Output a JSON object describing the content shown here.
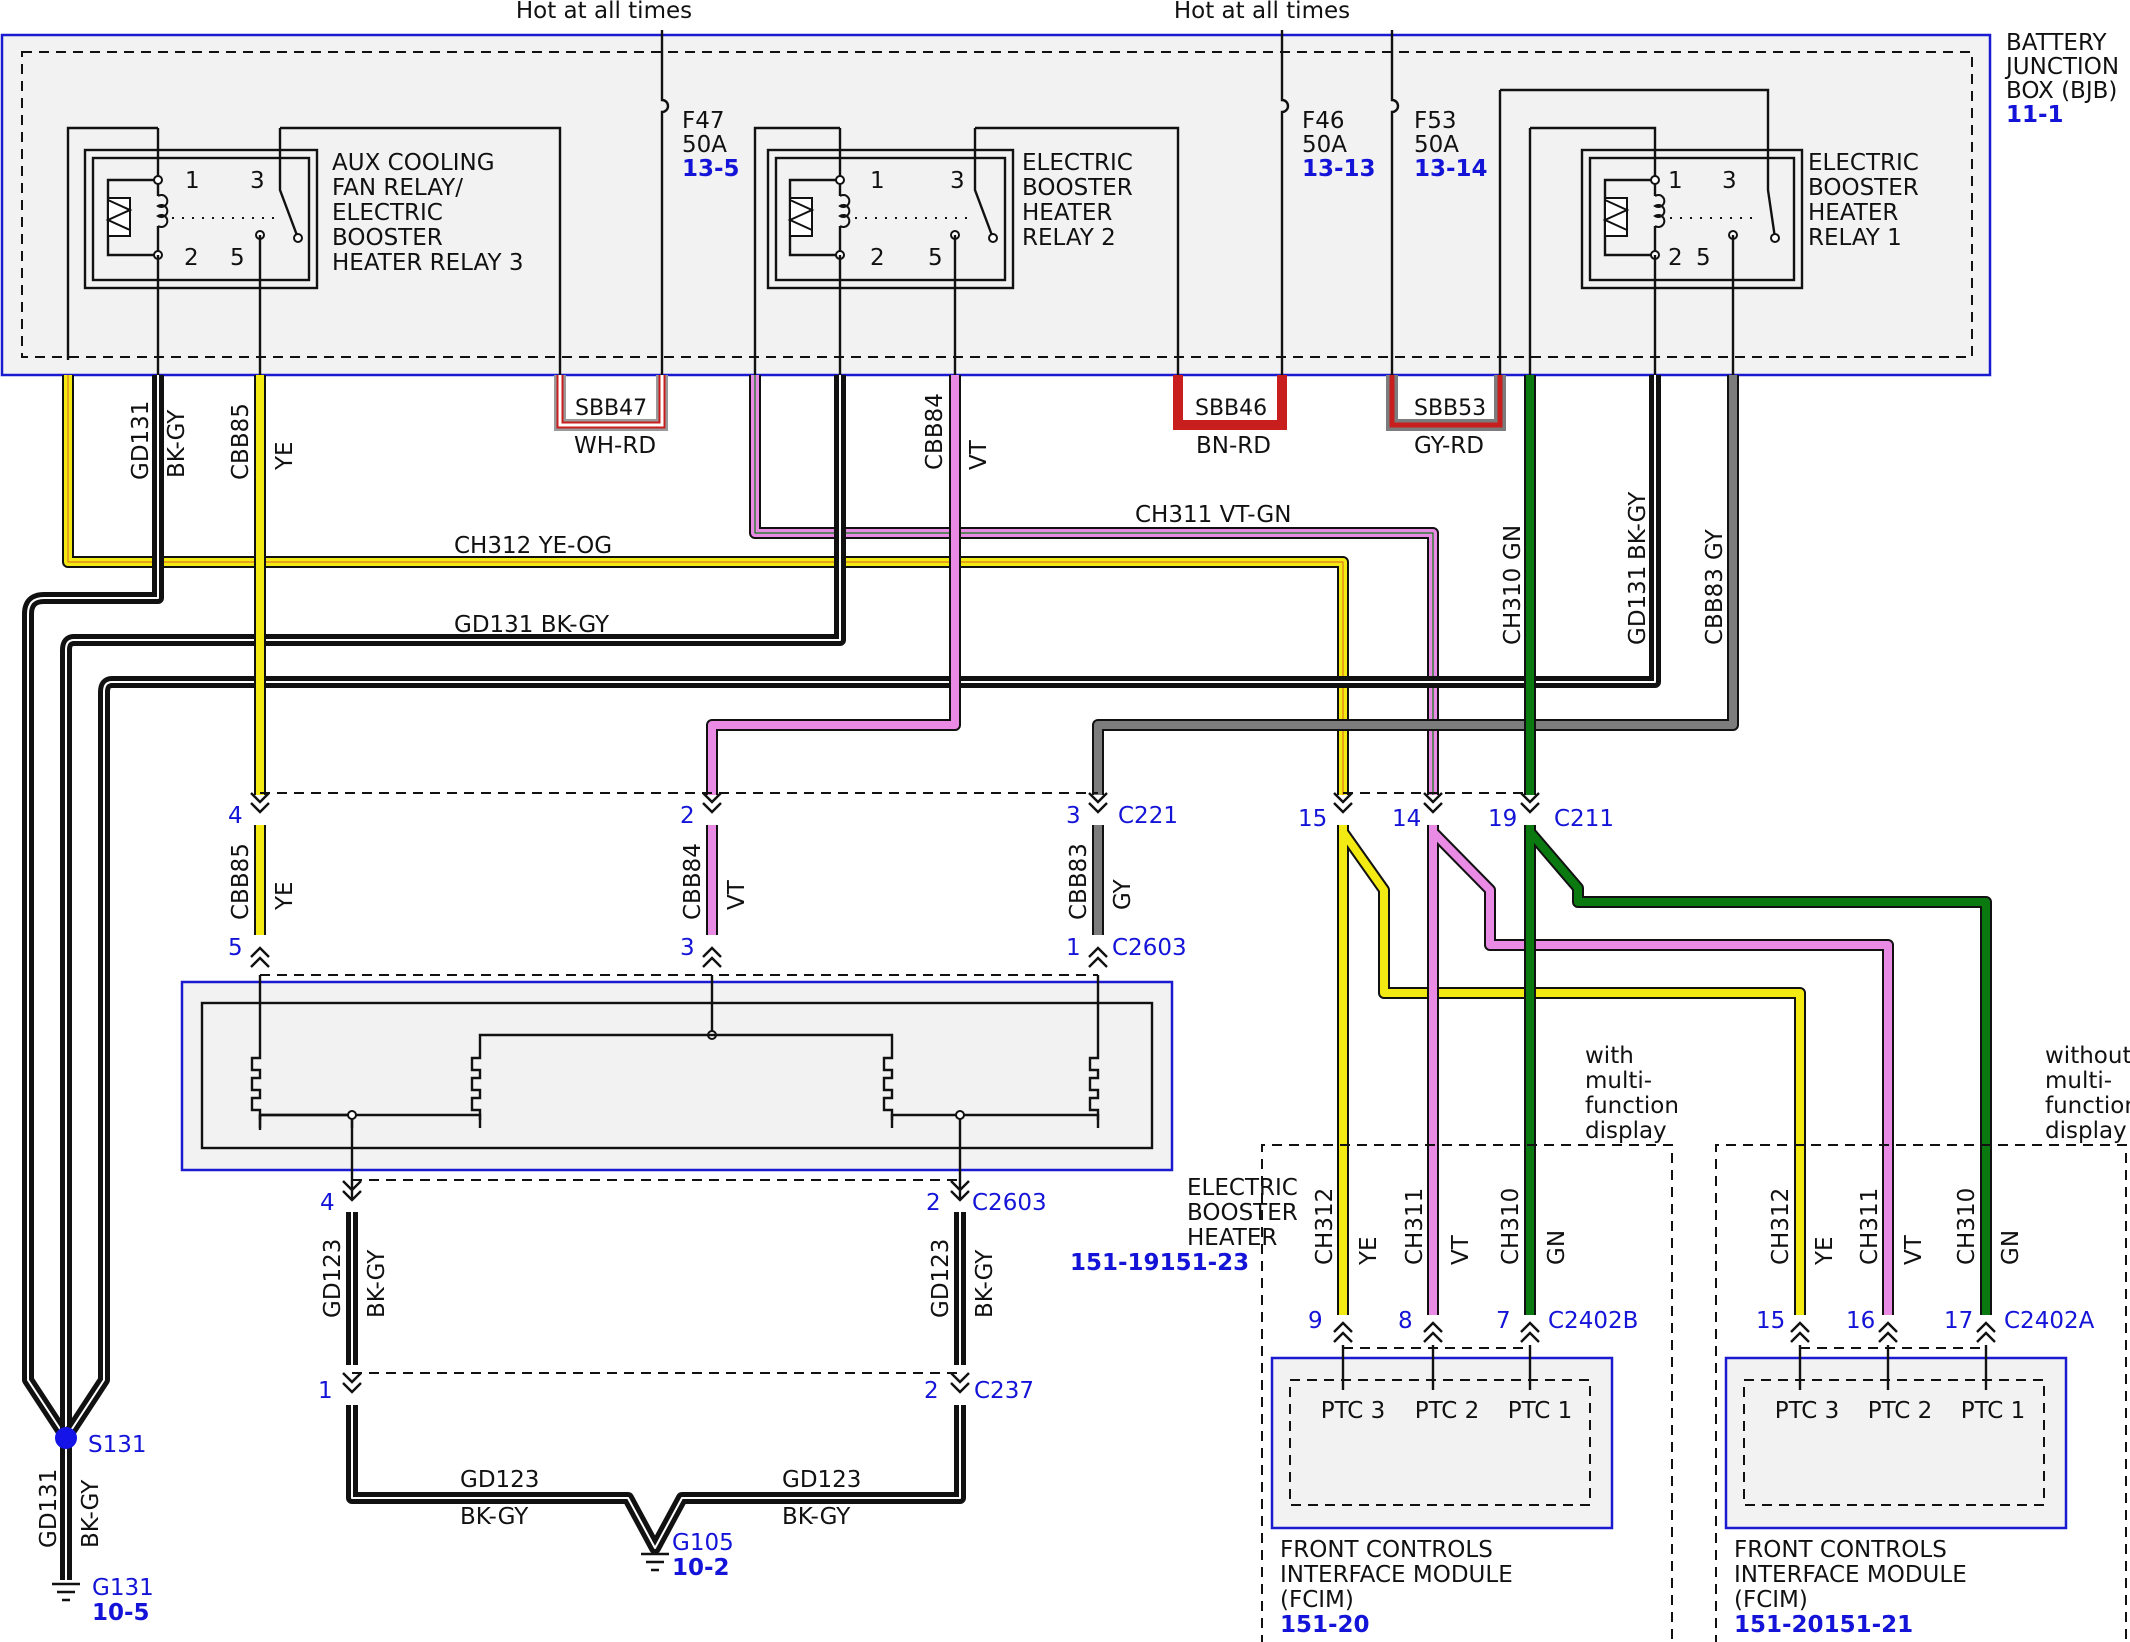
{
  "hot_label_1": "Hot at all times",
  "hot_label_2": "Hot at all times",
  "bjb": {
    "line1": "BATTERY",
    "line2": "JUNCTION",
    "line3": "BOX (BJB)",
    "ref": "11-1"
  },
  "relay3": {
    "l1": "AUX COOLING",
    "l2": "FAN RELAY/",
    "l3": "ELECTRIC",
    "l4": "BOOSTER",
    "l5": "HEATER RELAY 3",
    "p1": "1",
    "p2": "2",
    "p3": "3",
    "p5": "5"
  },
  "relay2": {
    "l1": "ELECTRIC",
    "l2": "BOOSTER",
    "l3": "HEATER",
    "l4": "RELAY 2",
    "p1": "1",
    "p2": "2",
    "p3": "3",
    "p5": "5"
  },
  "relay1": {
    "l1": "ELECTRIC",
    "l2": "BOOSTER",
    "l3": "HEATER",
    "l4": "RELAY 1",
    "p1": "1",
    "p2": "2",
    "p3": "3",
    "p5": "5"
  },
  "fuses": {
    "f47": {
      "name": "F47",
      "amps": "50A",
      "ref": "13-5"
    },
    "f46": {
      "name": "F46",
      "amps": "50A",
      "ref": "13-13"
    },
    "f53": {
      "name": "F53",
      "amps": "50A",
      "ref": "13-14"
    }
  },
  "busbars": {
    "sbb47": {
      "name": "SBB47",
      "color": "WH-RD"
    },
    "sbb46": {
      "name": "SBB46",
      "color": "BN-RD"
    },
    "sbb53": {
      "name": "SBB53",
      "color": "GY-RD"
    }
  },
  "wires": {
    "gd131": "GD131",
    "bkgy": "BK-GY",
    "cbb85": "CBB85",
    "ye": "YE",
    "cbb84": "CBB84",
    "vt": "VT",
    "cbb83": "CBB83",
    "gy": "GY",
    "ch310": "CH310",
    "gn": "GN",
    "ch311": "CH311",
    "ch312": "CH312",
    "gd123": "GD123",
    "ch312_yeog": "CH312  YE-OG",
    "ch311_vtgn": "CH311 VT-GN",
    "gd131_bkgy": "GD131  BK-GY"
  },
  "connectors": {
    "c221": {
      "name": "C221",
      "p4": "4",
      "p2": "2",
      "p3": "3"
    },
    "c2603_top": {
      "name": "C2603",
      "p5": "5",
      "p3": "3",
      "p1": "1"
    },
    "c211": {
      "name": "C211",
      "p15": "15",
      "p14": "14",
      "p19": "19"
    },
    "c2603_bot": {
      "name": "C2603",
      "p4": "4",
      "p2": "2"
    },
    "c237": {
      "name": "C237",
      "p1": "1",
      "p2": "2"
    },
    "c2402b": {
      "name": "C2402B",
      "p9": "9",
      "p8": "8",
      "p7": "7"
    },
    "c2402a": {
      "name": "C2402A",
      "p15": "15",
      "p16": "16",
      "p17": "17"
    }
  },
  "heater": {
    "l1": "ELECTRIC",
    "l2": "BOOSTER",
    "l3": "HEATER",
    "ref": "151-19151-23"
  },
  "grounds": {
    "s131": "S131",
    "g131": "G131",
    "g131_ref": "10-5",
    "g105": "G105",
    "g105_ref": "10-2"
  },
  "fcim_b": {
    "note1": "with",
    "note2": "multi-",
    "note3": "function",
    "note4": "display",
    "ptc3": "PTC 3",
    "ptc2": "PTC 2",
    "ptc1": "PTC 1",
    "l1": "FRONT CONTROLS",
    "l2": "INTERFACE MODULE",
    "l3": "(FCIM)",
    "ref": "151-20"
  },
  "fcim_a": {
    "note1": "without",
    "note2": "multi-",
    "note3": "function",
    "note4": "display",
    "ptc3": "PTC 3",
    "ptc2": "PTC 2",
    "ptc1": "PTC 1",
    "l1": "FRONT CONTROLS",
    "l2": "INTERFACE MODULE",
    "l3": "(FCIM)",
    "ref": "151-20151-21"
  },
  "colors": {
    "ye": "#f2ea12",
    "vt": "#e98ae4",
    "gy": "#7c7c7c",
    "gn": "#0a7a10",
    "bk": "#111111",
    "rd": "#c81e1e",
    "box_stroke": "#1a1ad0",
    "label_blue": "#1414d8"
  }
}
